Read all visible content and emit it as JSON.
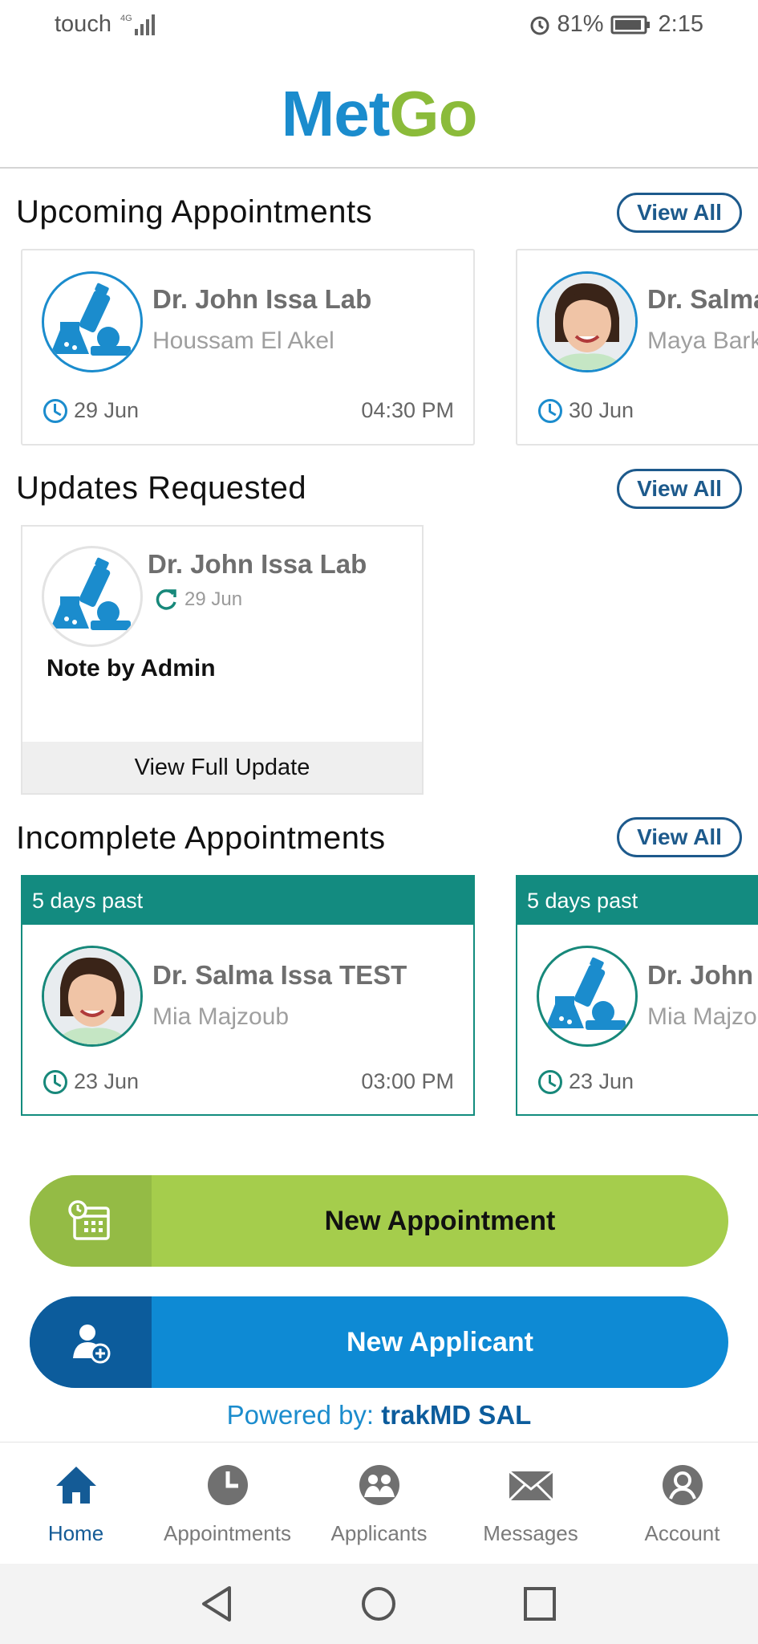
{
  "status_bar": {
    "carrier": "touch",
    "network": "4G",
    "battery": "81%",
    "time": "2:15"
  },
  "header": {
    "logo_part1": "Met",
    "logo_part2": "Go"
  },
  "upcoming": {
    "title": "Upcoming Appointments",
    "view_all": "View All",
    "cards": [
      {
        "doctor": "Dr. John Issa Lab",
        "patient": "Houssam El Akel",
        "date": "29 Jun",
        "time": "04:30 PM",
        "avatar": "lab-icon"
      },
      {
        "doctor": "Dr. Salma",
        "patient": "Maya Bark",
        "date": "30 Jun",
        "time": "",
        "avatar": "doctor-photo"
      }
    ]
  },
  "updates": {
    "title": "Updates Requested",
    "view_all": "View All",
    "card": {
      "doctor": "Dr. John Issa Lab",
      "date": "29 Jun",
      "note": "Note by Admin",
      "action": "View Full Update"
    }
  },
  "incomplete": {
    "title": "Incomplete Appointments",
    "view_all": "View All",
    "cards": [
      {
        "badge": "5 days past",
        "doctor": "Dr. Salma Issa TEST",
        "patient": "Mia Majzoub",
        "date": "23 Jun",
        "time": "03:00 PM",
        "avatar": "doctor-photo"
      },
      {
        "badge": "5 days past",
        "doctor": "Dr. John",
        "patient": "Mia Majzo",
        "date": "23 Jun",
        "time": "",
        "avatar": "lab-icon"
      }
    ]
  },
  "actions": {
    "new_appointment": "New Appointment",
    "new_applicant": "New Applicant"
  },
  "footer": {
    "powered_label": "Powered by:",
    "powered_company": "trakMD SAL"
  },
  "nav": [
    {
      "label": "Home",
      "icon": "home-icon",
      "active": true
    },
    {
      "label": "Appointments",
      "icon": "clock-icon",
      "active": false
    },
    {
      "label": "Applicants",
      "icon": "people-icon",
      "active": false
    },
    {
      "label": "Messages",
      "icon": "mail-icon",
      "active": false
    },
    {
      "label": "Account",
      "icon": "user-icon",
      "active": false
    }
  ],
  "colors": {
    "brand_blue": "#1b8ccd",
    "brand_green": "#8bbb3a",
    "teal": "#138b80",
    "navy": "#145b96"
  }
}
